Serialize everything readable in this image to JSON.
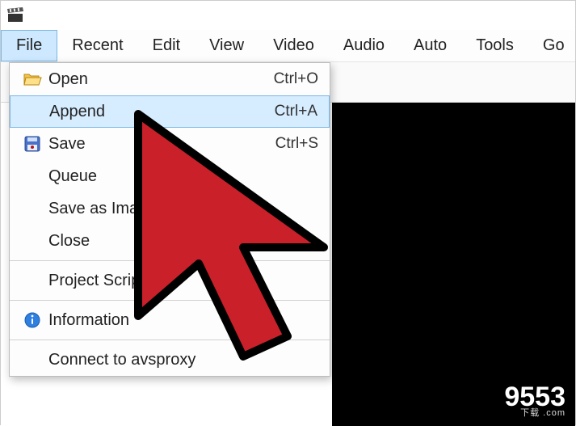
{
  "menubar": {
    "items": [
      "File",
      "Recent",
      "Edit",
      "View",
      "Video",
      "Audio",
      "Auto",
      "Tools",
      "Go"
    ],
    "active_index": 0
  },
  "file_menu": {
    "items": [
      {
        "label": "Open",
        "shortcut": "Ctrl+O",
        "icon": "folder-open"
      },
      {
        "label": "Append",
        "shortcut": "Ctrl+A",
        "icon": "",
        "highlight": true
      },
      {
        "label": "Save",
        "shortcut": "Ctrl+S",
        "icon": "save-disk"
      },
      {
        "label": "Queue",
        "shortcut": "",
        "icon": ""
      },
      {
        "label": "Save as Image",
        "shortcut": "",
        "icon": ""
      },
      {
        "label": "Close",
        "shortcut": "",
        "icon": ""
      },
      {
        "separator": true
      },
      {
        "label": "Project Script",
        "shortcut": "",
        "icon": ""
      },
      {
        "separator": true
      },
      {
        "label": "Information",
        "shortcut": "",
        "icon": "info"
      },
      {
        "separator": true
      },
      {
        "label": "Connect to avsproxy",
        "shortcut": "",
        "icon": ""
      }
    ]
  },
  "toolbar": {
    "buttons": [
      "folder-open",
      "save-disk",
      "arrow-in",
      "arrow-out"
    ]
  },
  "watermark": {
    "main": "9553",
    "sub": "下载 .com"
  }
}
